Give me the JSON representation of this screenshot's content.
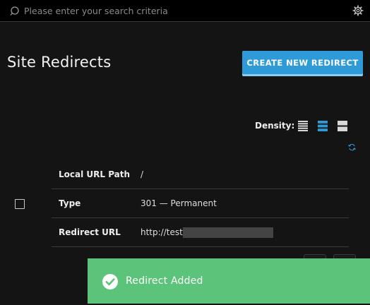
{
  "search": {
    "placeholder": "Please enter your search criteria",
    "value": ""
  },
  "header": {
    "title": "Site Redirects",
    "create_button_label": "CREATE NEW REDIRECT"
  },
  "density": {
    "label": "Density:",
    "options": [
      "compact",
      "standard",
      "comfortable"
    ],
    "selected": "standard"
  },
  "redirect": {
    "fields": [
      {
        "label": "Local URL Path",
        "value": "/"
      },
      {
        "label": "Type",
        "value": "301 — Permanent"
      },
      {
        "label": "Redirect URL",
        "value": "http://test."
      }
    ]
  },
  "toast": {
    "message": "Redirect Added",
    "icon": "check-circle-icon"
  },
  "colors": {
    "accent": "#2f9ad8",
    "success": "#5cc47a",
    "background": "#141414",
    "topbar": "#000000"
  }
}
